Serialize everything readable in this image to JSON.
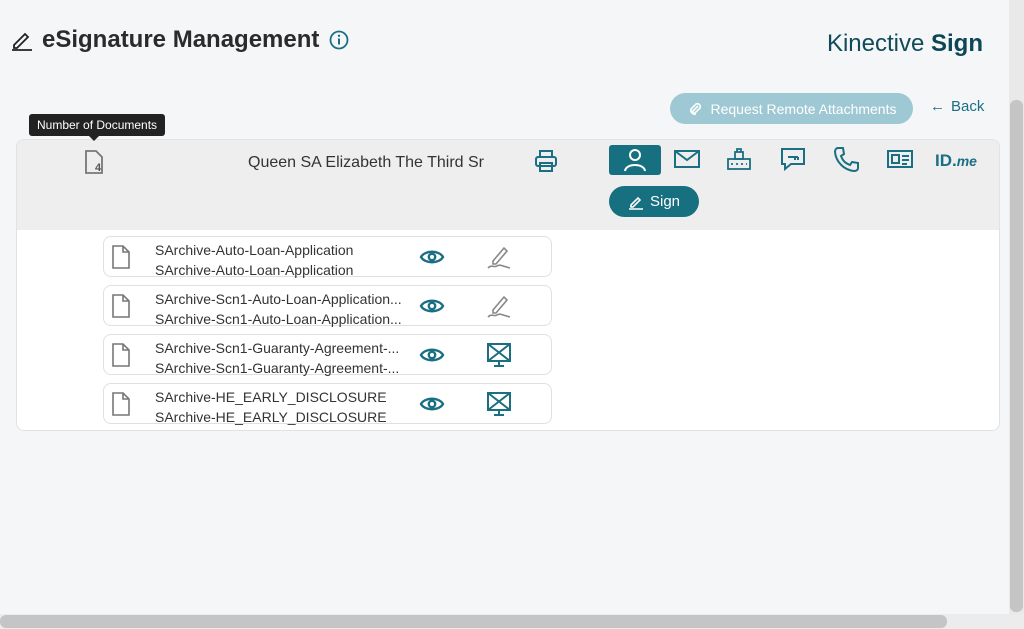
{
  "header": {
    "title": "eSignature Management",
    "brand_light": "Kinective",
    "brand_bold": "Sign",
    "remote_button": "Request Remote Attachments",
    "back_label": "Back"
  },
  "tooltip": "Number of Documents",
  "signer": {
    "name": "Queen SA Elizabeth The Third Sr",
    "document_count": "4",
    "auth_methods": [
      "user-icon",
      "email-icon",
      "knowledge-icon",
      "otp-icon",
      "phone-icon",
      "id-card-icon"
    ],
    "idme_brand": "ID.",
    "idme_suffix": "me",
    "sign_label": "Sign"
  },
  "documents": [
    {
      "line1": "SArchive-Auto-Loan-Application",
      "line2": "SArchive-Auto-Loan-Application",
      "action": "sign-icon"
    },
    {
      "line1": "SArchive-Scn1-Auto-Loan-Application...",
      "line2": "SArchive-Scn1-Auto-Loan-Application...",
      "action": "sign-icon"
    },
    {
      "line1": "SArchive-Scn1-Guaranty-Agreement-...",
      "line2": "SArchive-Scn1-Guaranty-Agreement-...",
      "action": "in-person-icon"
    },
    {
      "line1": "SArchive-HE_EARLY_DISCLOSURE",
      "line2": "SArchive-HE_EARLY_DISCLOSURE",
      "action": "in-person-icon"
    }
  ],
  "colors": {
    "accent": "#16707f",
    "accent_light": "#9ec8d3",
    "brand": "#114a5a"
  }
}
